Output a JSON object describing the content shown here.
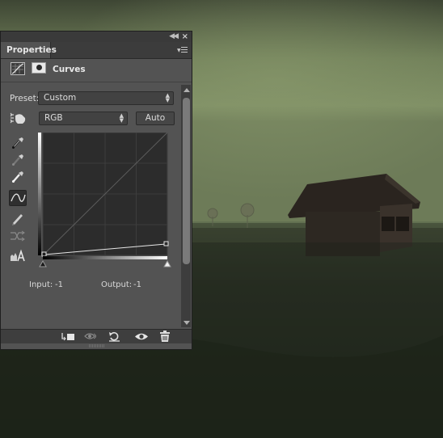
{
  "panel": {
    "tab_label": "Properties",
    "adjustment_title": "Curves",
    "preset_label": "Preset:",
    "preset_value": "Custom",
    "channel_value": "RGB",
    "auto_label": "Auto",
    "input_label": "Input:",
    "input_value": "-1",
    "output_label": "Output:",
    "output_value": "-1"
  },
  "icons": {
    "collapse": "double-chevron-left-icon",
    "close": "close-icon",
    "panel_menu": "panel-menu-icon",
    "adjustment": "curves-adjustment-icon",
    "mask": "layer-mask-icon",
    "on_image": "on-image-adjust-icon",
    "black_point": "black-point-eyedropper-icon",
    "gray_point": "gray-point-eyedropper-icon",
    "white_point": "white-point-eyedropper-icon",
    "curve_point": "curve-point-tool-icon",
    "pencil": "pencil-draw-icon",
    "smooth": "smooth-curve-icon",
    "clipping": "show-clipping-icon"
  },
  "colors": {
    "panel_bg": "#535353",
    "graph_bg": "#2c2c2c",
    "curve_line": "#e6e6e6"
  }
}
